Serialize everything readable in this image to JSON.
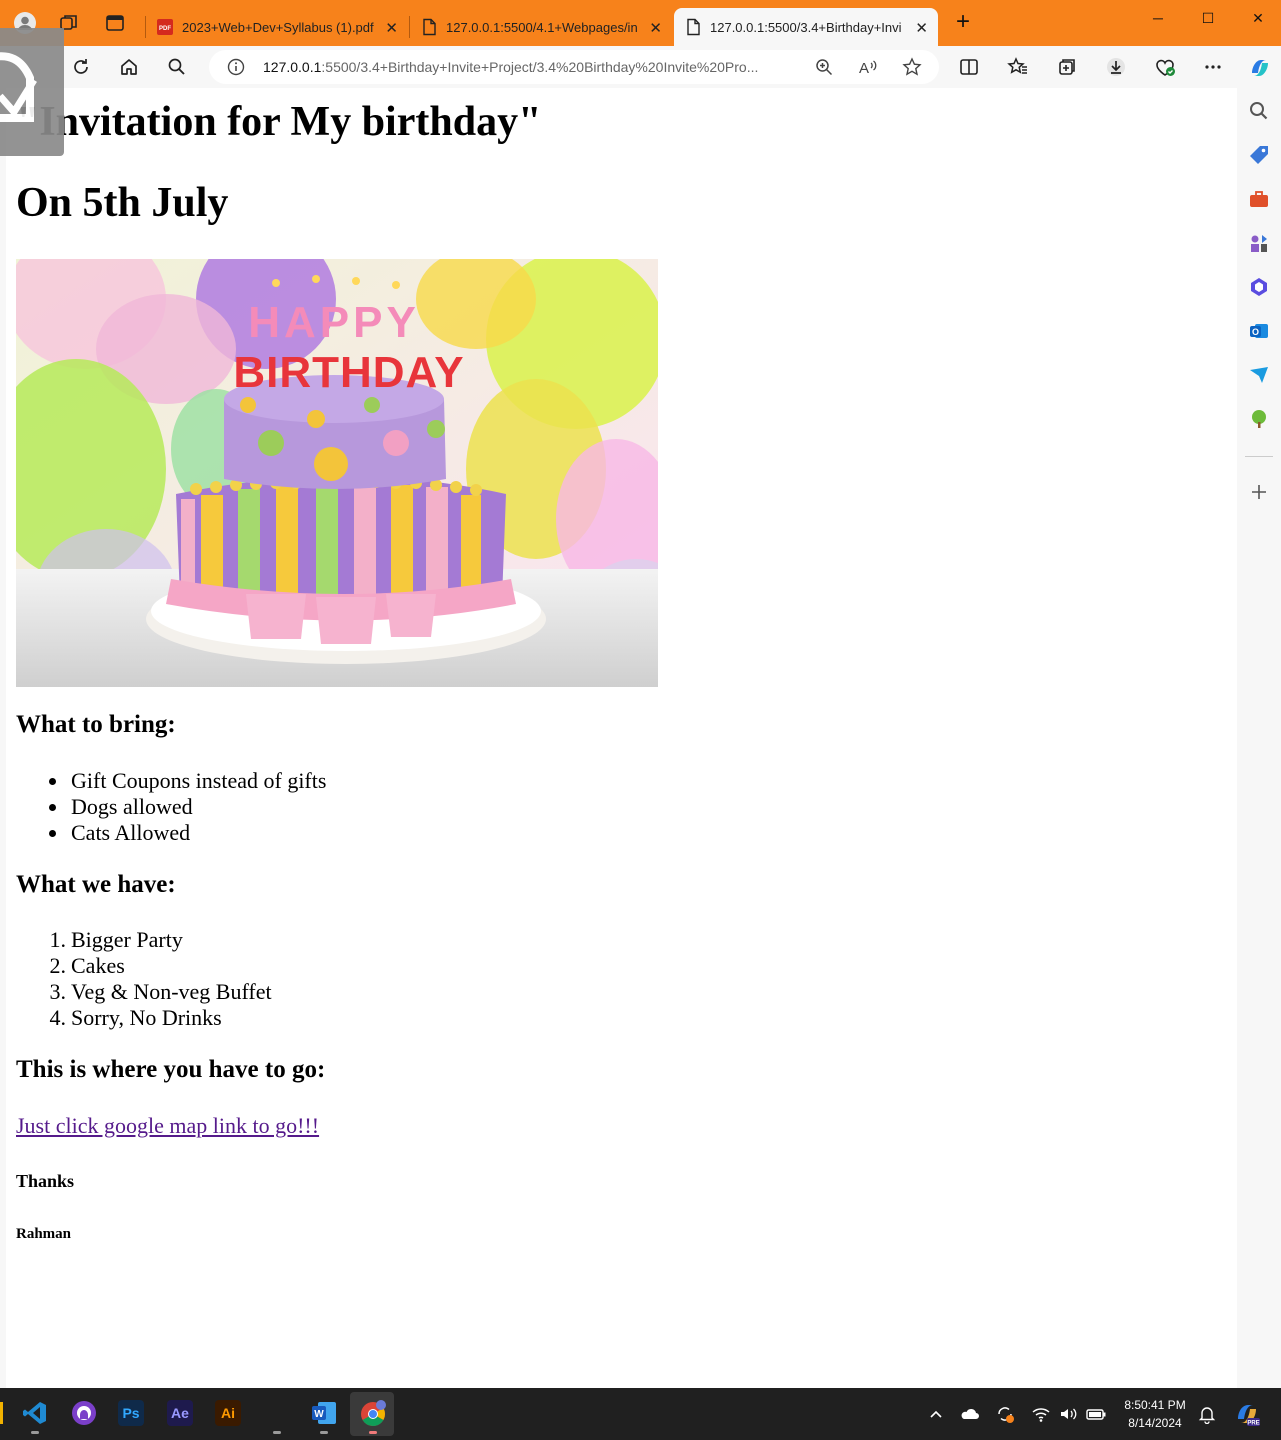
{
  "browser": {
    "tabs": [
      {
        "title": "2023+Web+Dev+Syllabus (1).pdf",
        "favicon": "pdf-icon",
        "active": false
      },
      {
        "title": "127.0.0.1:5500/4.1+Webpages/in",
        "favicon": "page-icon",
        "active": false
      },
      {
        "title": "127.0.0.1:5500/3.4+Birthday+Invi",
        "favicon": "page-icon",
        "active": true
      }
    ],
    "new_tab": "+",
    "address": {
      "host": "127.0.0.1",
      "path": ":5500/3.4+Birthday+Invite+Project/3.4%20Birthday%20Invite%20Pro..."
    },
    "accent_color": "#f7821b"
  },
  "page": {
    "title": "\"Invitation for My birthday\"",
    "date_heading": "On 5th July",
    "bring_heading": "What to bring:",
    "bring_items": [
      "Gift Coupons instead of gifts",
      "Dogs allowed",
      "Cats Allowed"
    ],
    "have_heading": "What we have:",
    "have_items": [
      "Bigger Party",
      "Cakes",
      "Veg & Non-veg Buffet",
      "Sorry, No Drinks"
    ],
    "go_heading": "This is where you have to go:",
    "map_link": "Just click google map link to go!!!",
    "thanks": "Thanks",
    "signature": "Rahman",
    "image": {
      "cake_text": "HAPPY BIRTHDAY"
    }
  },
  "taskbar": {
    "apps": [
      "vscode",
      "github-desktop",
      "photoshop",
      "after-effects",
      "illustrator",
      "word",
      "chrome"
    ],
    "ps_label": "Ps",
    "ae_label": "Ae",
    "ai_label": "Ai",
    "time": "8:50:41 PM",
    "date": "8/14/2024"
  }
}
